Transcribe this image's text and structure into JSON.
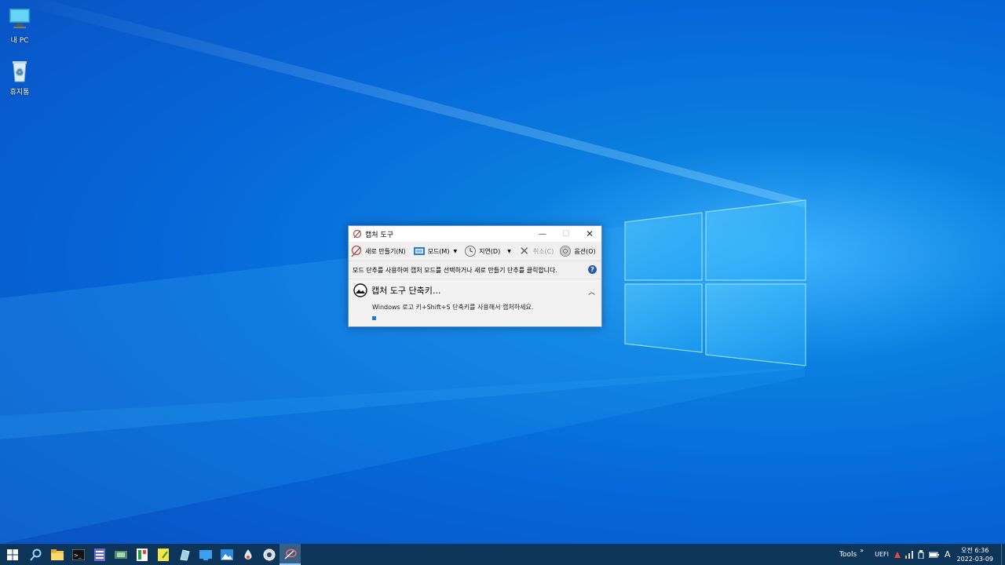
{
  "desktop": {
    "icons": [
      {
        "label": "내 PC",
        "icon": "computer-icon"
      },
      {
        "label": "휴지통",
        "icon": "recycle-bin-icon"
      }
    ]
  },
  "window": {
    "title": "캡처 도구",
    "toolbar": {
      "new_label": "새로 만들기(N)",
      "mode_label": "모드(M)",
      "delay_label": "지연(D)",
      "cancel_label": "취소(C)",
      "options_label": "옵션(O)"
    },
    "info_text": "모드 단추를 사용하여 캡처 모드를 선택하거나 새로 만들기 단추를 클릭합니다.",
    "help_label": "?",
    "panel": {
      "title": "캡처 도구 단축키...",
      "description": "Windows 로고 키+Shift+S 단축키를 사용해서 캡처하세요."
    }
  },
  "taskbar": {
    "tray": {
      "tools_label": "Tools",
      "overflow": "»",
      "uefi_label": "UEFI",
      "ime_label": "A",
      "time": "오전 6:36",
      "date": "2022-03-09"
    }
  },
  "colors": {
    "accent": "#1e7be0",
    "taskbar": "#0d3559"
  }
}
